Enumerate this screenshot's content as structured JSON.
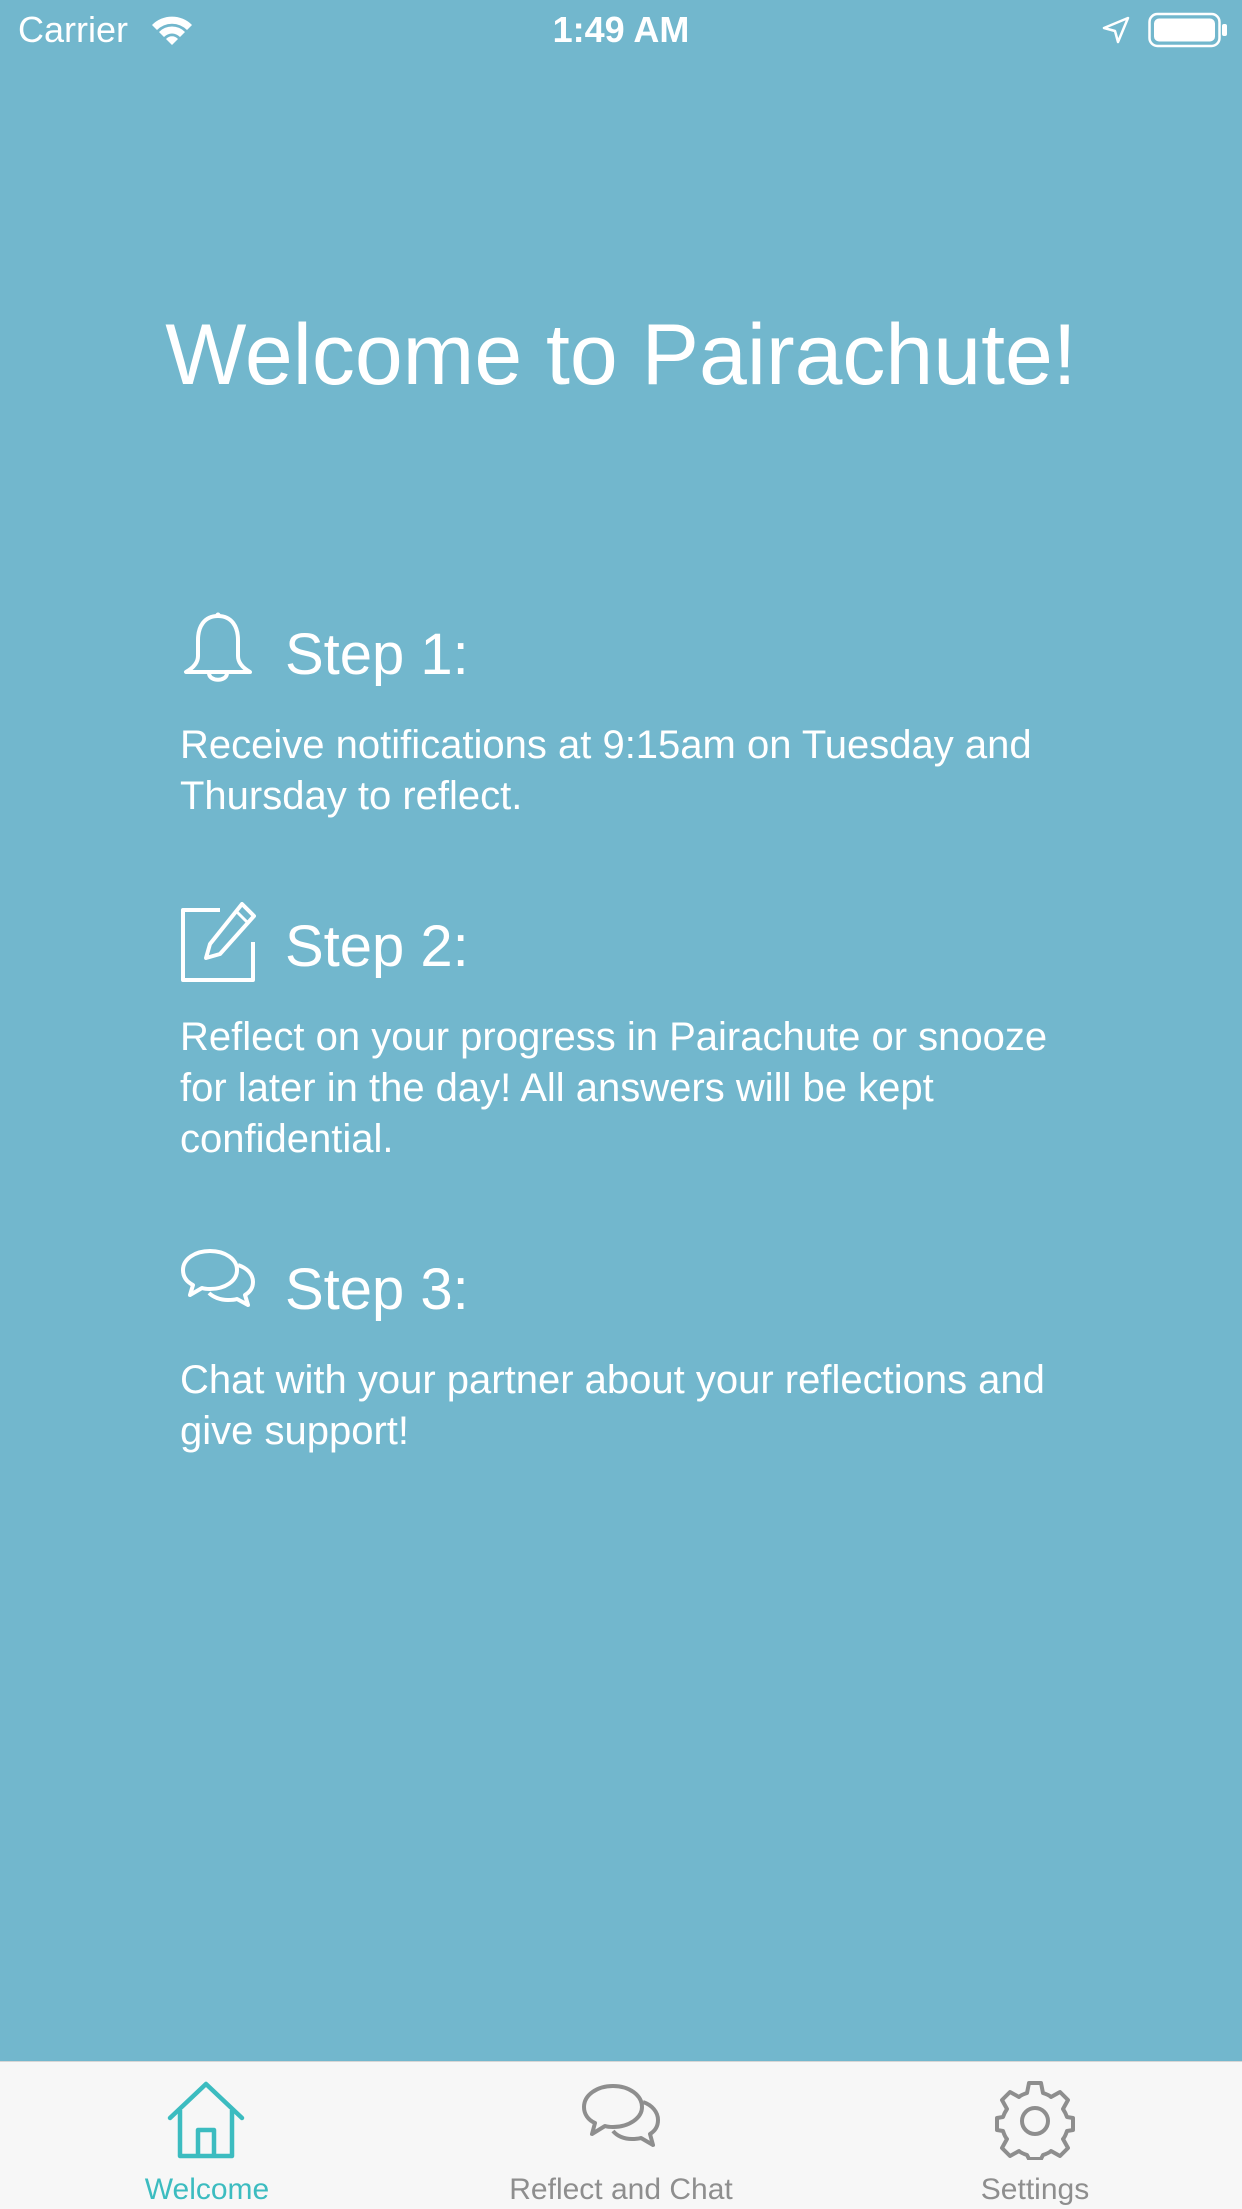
{
  "status_bar": {
    "carrier": "Carrier",
    "time": "1:49 AM",
    "icons": [
      "wifi-icon",
      "location-arrow-icon",
      "battery-icon"
    ]
  },
  "main": {
    "title": "Welcome to Pairachute!",
    "steps": [
      {
        "icon": "bell-icon",
        "title": "Step 1:",
        "text": "Receive notifications at 9:15am on Tuesday and Thursday to reflect."
      },
      {
        "icon": "edit-icon",
        "title": "Step 2:",
        "text": "Reflect on your progress in Pairachute or snooze for later in the day! All answers will be kept confidential."
      },
      {
        "icon": "chat-bubbles-icon",
        "title": "Step 3:",
        "text": "Chat with your partner about your reflections and give support!"
      }
    ]
  },
  "tab_bar": {
    "tabs": [
      {
        "label": "Welcome",
        "icon": "home-icon",
        "selected": true
      },
      {
        "label": "Reflect and Chat",
        "icon": "chat-bubbles-icon",
        "selected": false
      },
      {
        "label": "Settings",
        "icon": "gear-icon",
        "selected": false
      }
    ]
  },
  "colors": {
    "background": "#72b7cd",
    "text": "#ffffff",
    "tab_bar_background": "#f7f7f7",
    "tab_active": "#3cbcc0",
    "tab_inactive": "#8e8e8e"
  }
}
